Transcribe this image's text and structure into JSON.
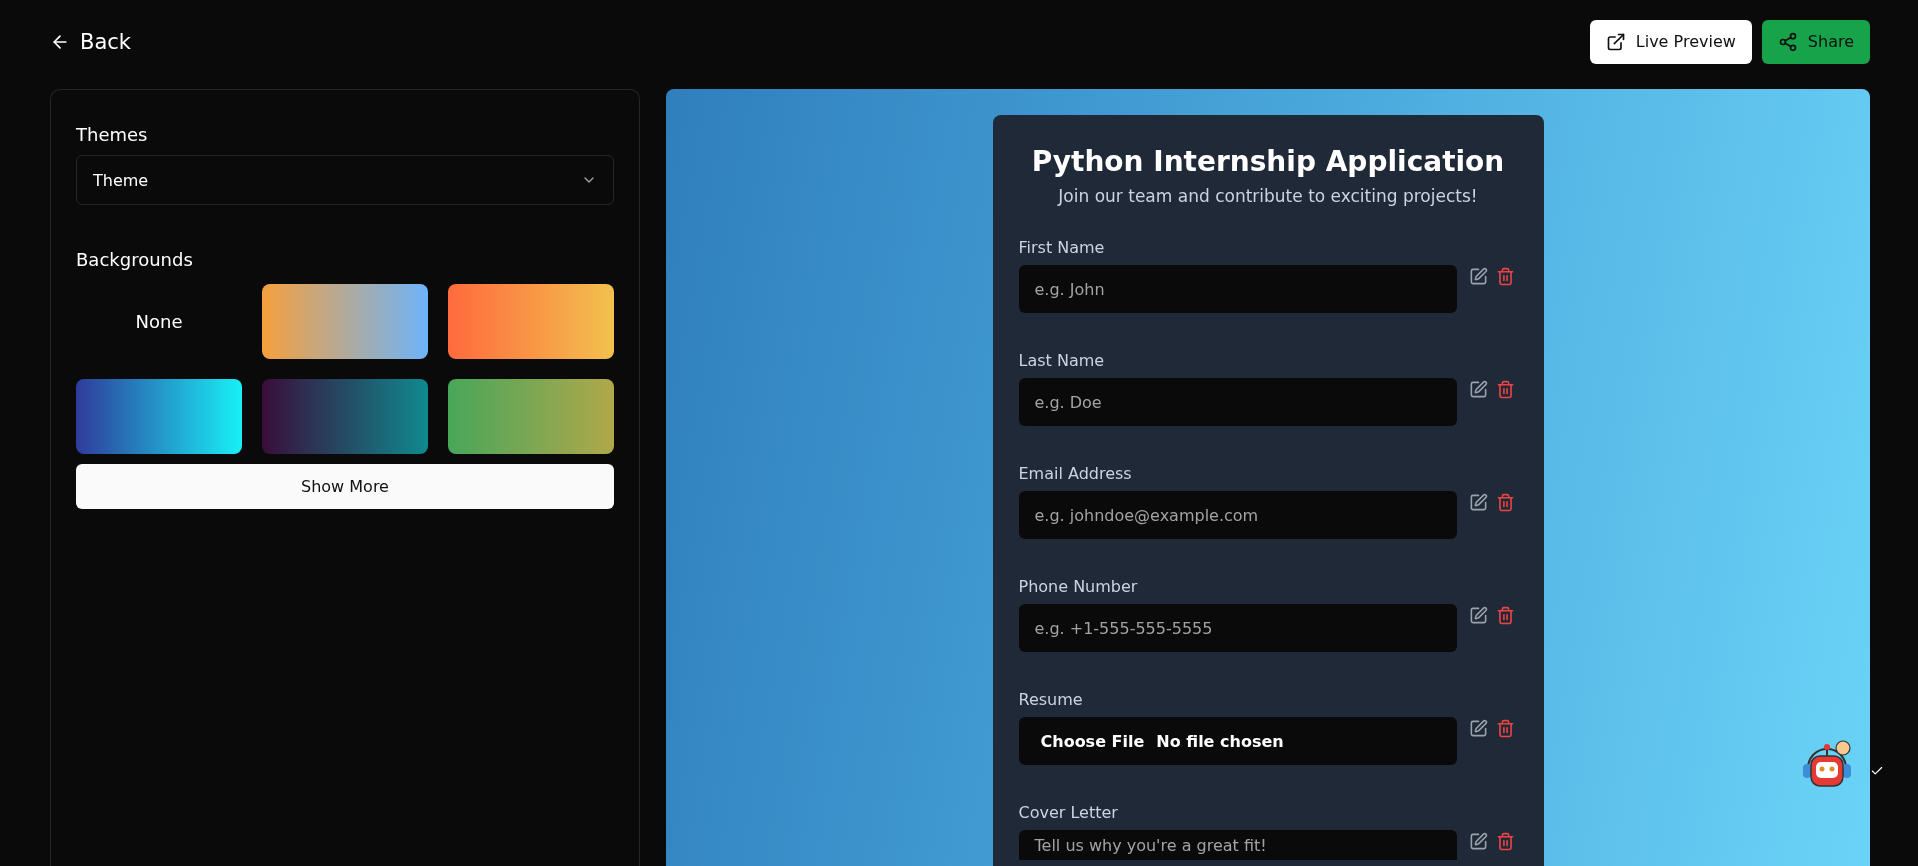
{
  "header": {
    "back": "Back",
    "buttons": [
      {
        "kind": "preview",
        "label": "Live Preview"
      },
      {
        "kind": "share",
        "label": "Share"
      }
    ]
  },
  "sidebar": {
    "themes_label": "Themes",
    "theme_select": {
      "value": "Theme"
    },
    "backgrounds_label": "Backgrounds",
    "backgrounds": [
      {
        "kind": "none",
        "label": "None"
      },
      {
        "kind": "gradient",
        "colors": [
          {
            "color": "#f6a03d"
          },
          {
            "color": "#6db4fa"
          }
        ]
      },
      {
        "kind": "gradient",
        "colors": [
          {
            "color": "#ff6a3d"
          },
          {
            "color": "#f2c14e"
          }
        ]
      },
      {
        "kind": "gradient",
        "colors": [
          {
            "color": "#2f3b9a"
          },
          {
            "color": "#18f0f7"
          }
        ]
      },
      {
        "kind": "gradient",
        "colors": [
          {
            "color": "#3a0d3a"
          },
          {
            "color": "#0f8a8f"
          }
        ]
      },
      {
        "kind": "gradient",
        "colors": [
          {
            "color": "#48a65a"
          },
          {
            "color": "#b0a84a"
          }
        ]
      }
    ],
    "show_more": "Show More"
  },
  "form": {
    "title": "Python Internship Application",
    "subtitle": "Join our team and contribute to exciting projects!",
    "fields": [
      {
        "kind": "text",
        "label": "First Name",
        "placeholder": "e.g. John"
      },
      {
        "kind": "text",
        "label": "Last Name",
        "placeholder": "e.g. Doe"
      },
      {
        "kind": "text",
        "label": "Email Address",
        "placeholder": "e.g. johndoe@example.com"
      },
      {
        "kind": "text",
        "label": "Phone Number",
        "placeholder": "e.g. +1-555-555-5555"
      },
      {
        "kind": "file",
        "label": "Resume",
        "button": "Choose File",
        "status": "No file chosen"
      },
      {
        "kind": "textarea",
        "label": "Cover Letter",
        "placeholder": "Tell us why you're a great fit!"
      }
    ]
  }
}
